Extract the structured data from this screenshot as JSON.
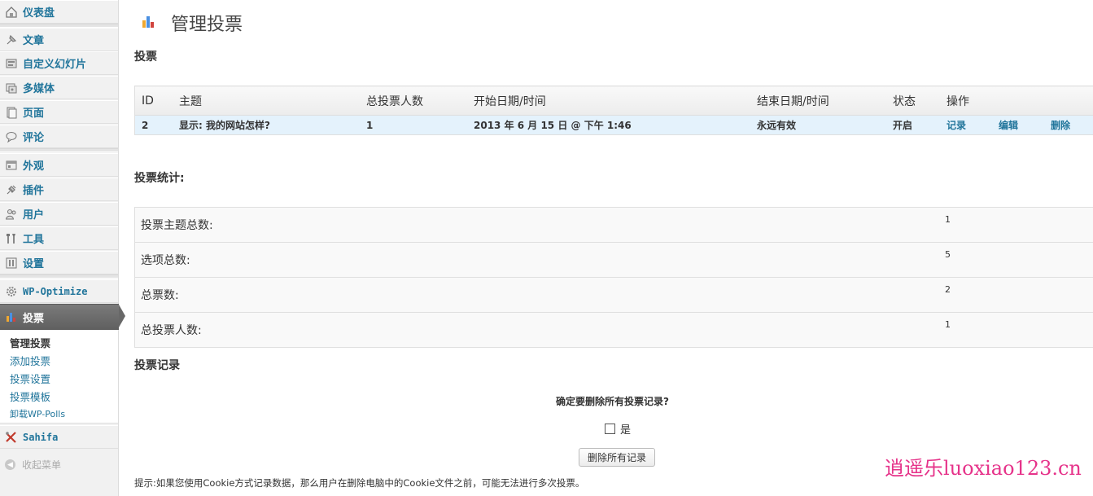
{
  "sidebar": {
    "items": [
      {
        "label": "仪表盘",
        "icon": "dashboard-icon"
      },
      {
        "label": "文章",
        "icon": "pushpin-icon"
      },
      {
        "label": "自定义幻灯片",
        "icon": "slides-icon"
      },
      {
        "label": "多媒体",
        "icon": "media-icon"
      },
      {
        "label": "页面",
        "icon": "page-icon"
      },
      {
        "label": "评论",
        "icon": "comment-icon"
      },
      {
        "label": "外观",
        "icon": "appearance-icon"
      },
      {
        "label": "插件",
        "icon": "plugin-icon"
      },
      {
        "label": "用户",
        "icon": "users-icon"
      },
      {
        "label": "工具",
        "icon": "tools-icon"
      },
      {
        "label": "设置",
        "icon": "settings-icon"
      },
      {
        "label": "WP-Optimize",
        "icon": "gear-icon"
      },
      {
        "label": "投票",
        "icon": "poll-chart-icon"
      },
      {
        "label": "Sahifa",
        "icon": "wrench-icon"
      }
    ],
    "submenu": [
      "管理投票",
      "添加投票",
      "投票设置",
      "投票模板",
      "卸载WP-Polls"
    ],
    "collapse_label": "收起菜单"
  },
  "page": {
    "title": "管理投票",
    "section_polls": "投票",
    "section_stats": "投票统计:",
    "section_logs": "投票记录"
  },
  "polls_table": {
    "headers": [
      "ID",
      "主题",
      "总投票人数",
      "开始日期/时间",
      "结束日期/时间",
      "状态",
      "操作"
    ],
    "rows": [
      {
        "id": "2",
        "question": "显示: 我的网站怎样?",
        "total_voters": "1",
        "start": "2013 年 6 月 15 日 @ 下午 1:46",
        "end": "永远有效",
        "status": "开启",
        "actions": [
          "记录",
          "编辑",
          "删除"
        ]
      }
    ]
  },
  "stats_table": {
    "rows": [
      {
        "label": "投票主题总数:",
        "value": "1"
      },
      {
        "label": "选项总数:",
        "value": "5"
      },
      {
        "label": "总票数:",
        "value": "2"
      },
      {
        "label": "总投票人数:",
        "value": "1"
      }
    ]
  },
  "logs": {
    "confirm_question": "确定要删除所有投票记录?",
    "checkbox_label": "是",
    "delete_button": "删除所有记录",
    "tip": "提示:如果您使用Cookie方式记录数据，那么用户在删除电脑中的Cookie文件之前，可能无法进行多次投票。"
  },
  "watermark": "逍遥乐luoxiao123.cn",
  "colors": {
    "link": "#21759b",
    "active_menu": "#6a6a6a",
    "selected_row": "#e4f2fc",
    "watermark": "#e6338a"
  }
}
